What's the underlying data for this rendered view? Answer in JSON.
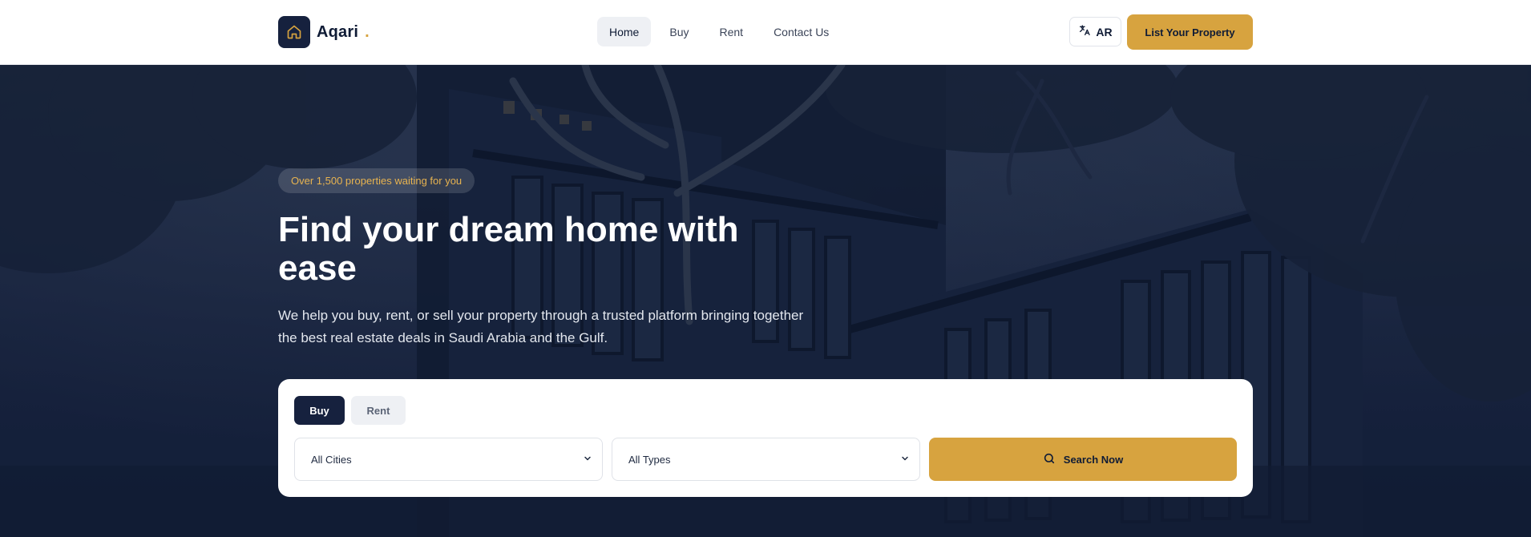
{
  "brand": {
    "name": "Aqari",
    "dot": ".",
    "logo_icon": "home-icon"
  },
  "nav": {
    "items": [
      {
        "label": "Home",
        "active": true
      },
      {
        "label": "Buy",
        "active": false
      },
      {
        "label": "Rent",
        "active": false
      },
      {
        "label": "Contact Us",
        "active": false
      }
    ]
  },
  "header": {
    "language_label": "AR",
    "language_icon": "translate-icon",
    "list_property_label": "List Your Property"
  },
  "hero": {
    "badge": "Over 1,500 properties waiting for you",
    "title": "Find your dream home with ease",
    "subtitle": "We help you buy, rent, or sell your property through a trusted platform bringing together the best real estate deals in Saudi Arabia and the Gulf."
  },
  "search": {
    "tabs": [
      {
        "label": "Buy",
        "active": true
      },
      {
        "label": "Rent",
        "active": false
      }
    ],
    "city_value": "All Cities",
    "type_value": "All Types",
    "button_label": "Search Now",
    "button_icon": "search-icon"
  },
  "colors": {
    "navy": "#16213e",
    "gold": "#d7a33f",
    "badge_text": "#e7b350"
  }
}
